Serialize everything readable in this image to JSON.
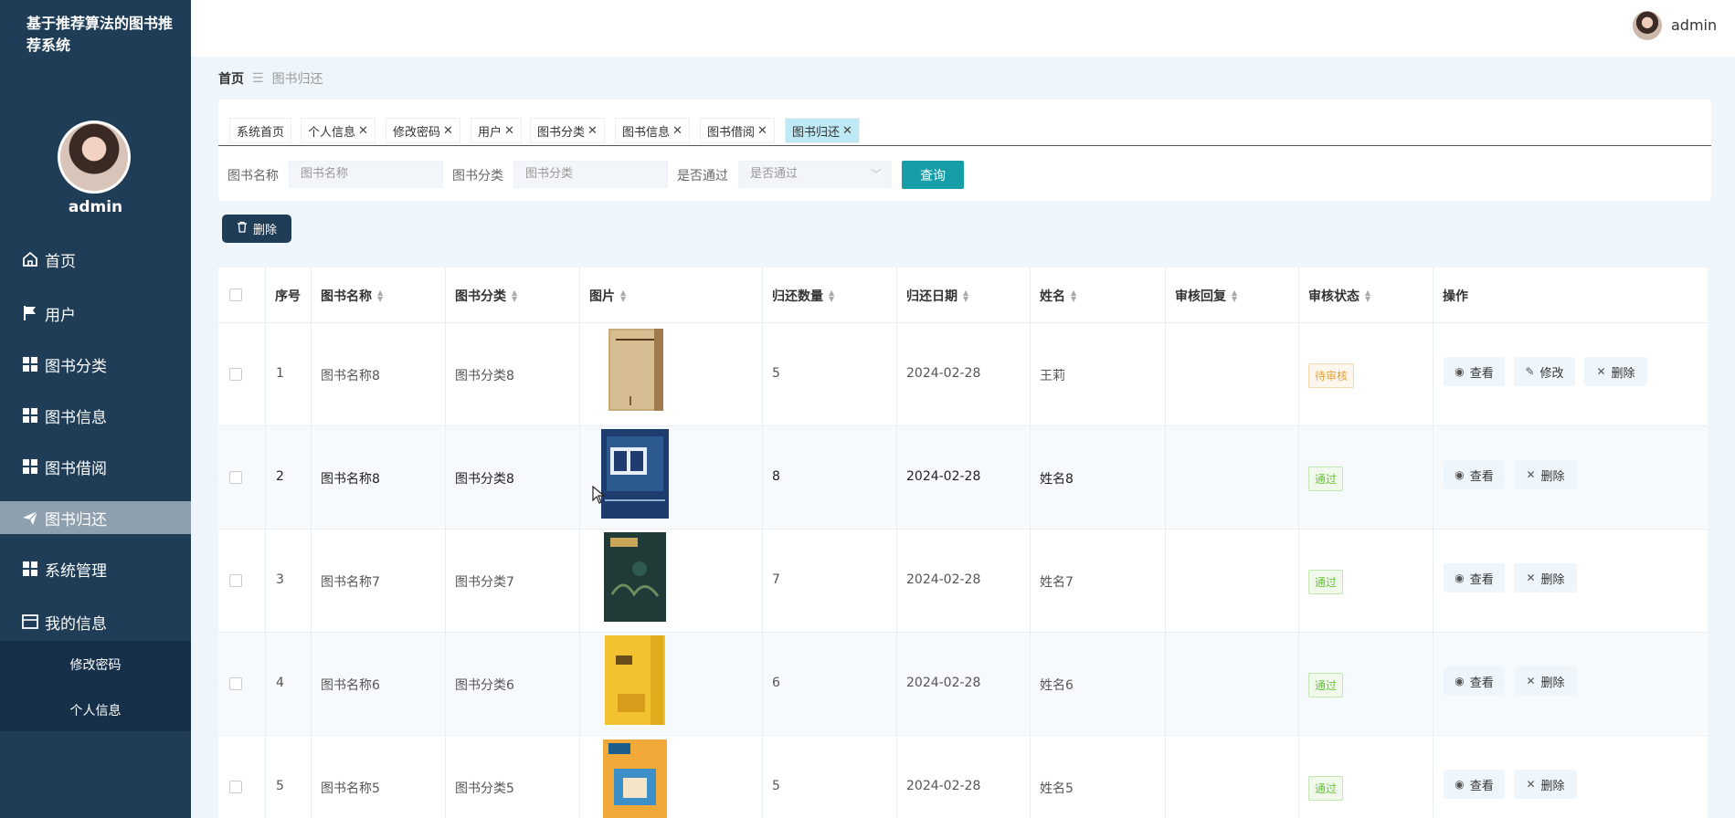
{
  "app": {
    "title": "基于推荐算法的图书推荐系统"
  },
  "sidebar": {
    "username": "admin",
    "items": [
      {
        "label": "首页",
        "icon": "home-icon"
      },
      {
        "label": "用户",
        "icon": "flag-icon"
      },
      {
        "label": "图书分类",
        "icon": "grid-icon"
      },
      {
        "label": "图书信息",
        "icon": "grid-icon"
      },
      {
        "label": "图书借阅",
        "icon": "grid-icon"
      },
      {
        "label": "图书归还",
        "icon": "send-icon",
        "active": true
      },
      {
        "label": "系统管理",
        "icon": "grid-icon"
      },
      {
        "label": "我的信息",
        "icon": "card-icon"
      }
    ],
    "subitems": [
      "修改密码",
      "个人信息"
    ]
  },
  "header": {
    "username": "admin"
  },
  "breadcrumb": {
    "home": "首页",
    "current": "图书归还"
  },
  "tabs": [
    {
      "label": "系统首页",
      "closable": false
    },
    {
      "label": "个人信息",
      "closable": true
    },
    {
      "label": "修改密码",
      "closable": true
    },
    {
      "label": "用户",
      "closable": true
    },
    {
      "label": "图书分类",
      "closable": true
    },
    {
      "label": "图书信息",
      "closable": true
    },
    {
      "label": "图书借阅",
      "closable": true
    },
    {
      "label": "图书归还",
      "closable": true,
      "active": true
    }
  ],
  "search": {
    "name_label": "图书名称",
    "name_placeholder": "图书名称",
    "category_label": "图书分类",
    "category_placeholder": "图书分类",
    "passed_label": "是否通过",
    "passed_placeholder": "是否通过",
    "query_button": "查询"
  },
  "toolbar": {
    "delete_label": "删除"
  },
  "table": {
    "columns": [
      "序号",
      "图书名称",
      "图书分类",
      "图片",
      "归还数量",
      "归还日期",
      "姓名",
      "审核回复",
      "审核状态",
      "操作"
    ],
    "rows": [
      {
        "index": "1",
        "name": "图书名称8",
        "category": "图书分类8",
        "quantity": "5",
        "date": "2024-02-28",
        "person": "王莉",
        "reply": "",
        "status": "待审核",
        "status_type": "pending",
        "actions": [
          "查看",
          "修改",
          "删除"
        ]
      },
      {
        "index": "2",
        "name": "图书名称8",
        "category": "图书分类8",
        "quantity": "8",
        "date": "2024-02-28",
        "person": "姓名8",
        "reply": "",
        "status": "通过",
        "status_type": "pass",
        "actions": [
          "查看",
          "删除"
        ]
      },
      {
        "index": "3",
        "name": "图书名称7",
        "category": "图书分类7",
        "quantity": "7",
        "date": "2024-02-28",
        "person": "姓名7",
        "reply": "",
        "status": "通过",
        "status_type": "pass",
        "actions": [
          "查看",
          "删除"
        ]
      },
      {
        "index": "4",
        "name": "图书名称6",
        "category": "图书分类6",
        "quantity": "6",
        "date": "2024-02-28",
        "person": "姓名6",
        "reply": "",
        "status": "通过",
        "status_type": "pass",
        "actions": [
          "查看",
          "删除"
        ]
      },
      {
        "index": "5",
        "name": "图书名称5",
        "category": "图书分类5",
        "quantity": "5",
        "date": "2024-02-28",
        "person": "姓名5",
        "reply": "",
        "status": "通过",
        "status_type": "pass",
        "actions": [
          "查看",
          "删除"
        ]
      }
    ]
  }
}
